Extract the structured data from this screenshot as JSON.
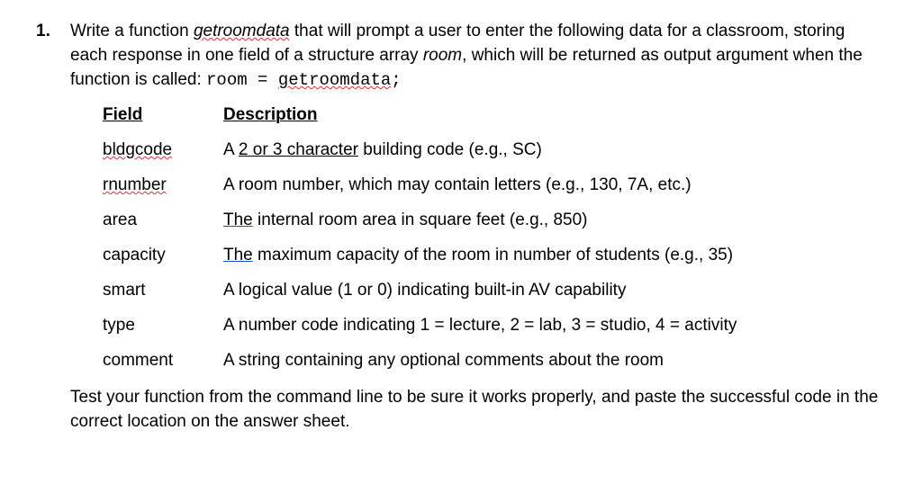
{
  "question": {
    "number": "1.",
    "intro_parts": {
      "p1a": "Write a function ",
      "funcname": "getroomdata",
      "p1b": " that will prompt a user to enter the following data for a classroom, storing each response in one field of a structure array ",
      "room_italic": "room",
      "p1c": ", which will be returned as output argument when the function is called:  ",
      "code1": "room = ",
      "code_func": "getroomdata",
      "code_semicolon": ";"
    },
    "table": {
      "header": {
        "field": "Field",
        "desc": "Description"
      },
      "rows": [
        {
          "field_text": "bldgcode",
          "field_style": "squiggle-red",
          "desc_pre": "A ",
          "desc_mid": "2 or 3 character",
          "desc_mid_style": "straight-underline",
          "desc_post": " building code (e.g., SC)"
        },
        {
          "field_text": "rnumber",
          "field_style": "squiggle-red",
          "desc_pre": "A room number, which may contain letters (e.g., 130, 7A, etc.)",
          "desc_mid": "",
          "desc_mid_style": "",
          "desc_post": ""
        },
        {
          "field_text": "area",
          "field_style": "",
          "desc_pre": "",
          "desc_mid": "The",
          "desc_mid_style": "squiggle-blue",
          "desc_post": " internal room area in square feet (e.g., 850)"
        },
        {
          "field_text": "capacity",
          "field_style": "",
          "desc_pre": "",
          "desc_mid": "The",
          "desc_mid_style": "squiggle-blue",
          "desc_post": " maximum capacity of the room in number of students (e.g., 35)"
        },
        {
          "field_text": "smart",
          "field_style": "",
          "desc_pre": "A logical value (1 or 0) indicating built-in AV capability",
          "desc_mid": "",
          "desc_mid_style": "",
          "desc_post": ""
        },
        {
          "field_text": "type",
          "field_style": "",
          "desc_pre": "A number code indicating 1 = lecture, 2 = lab, 3 = studio, 4 = activity",
          "desc_mid": "",
          "desc_mid_style": "",
          "desc_post": ""
        },
        {
          "field_text": "comment",
          "field_style": "",
          "desc_pre": "A string containing any optional comments about the room",
          "desc_mid": "",
          "desc_mid_style": "",
          "desc_post": ""
        }
      ]
    },
    "closing": "Test your function from the command line to be sure it works properly, and paste the successful code in the correct location on the answer sheet."
  }
}
